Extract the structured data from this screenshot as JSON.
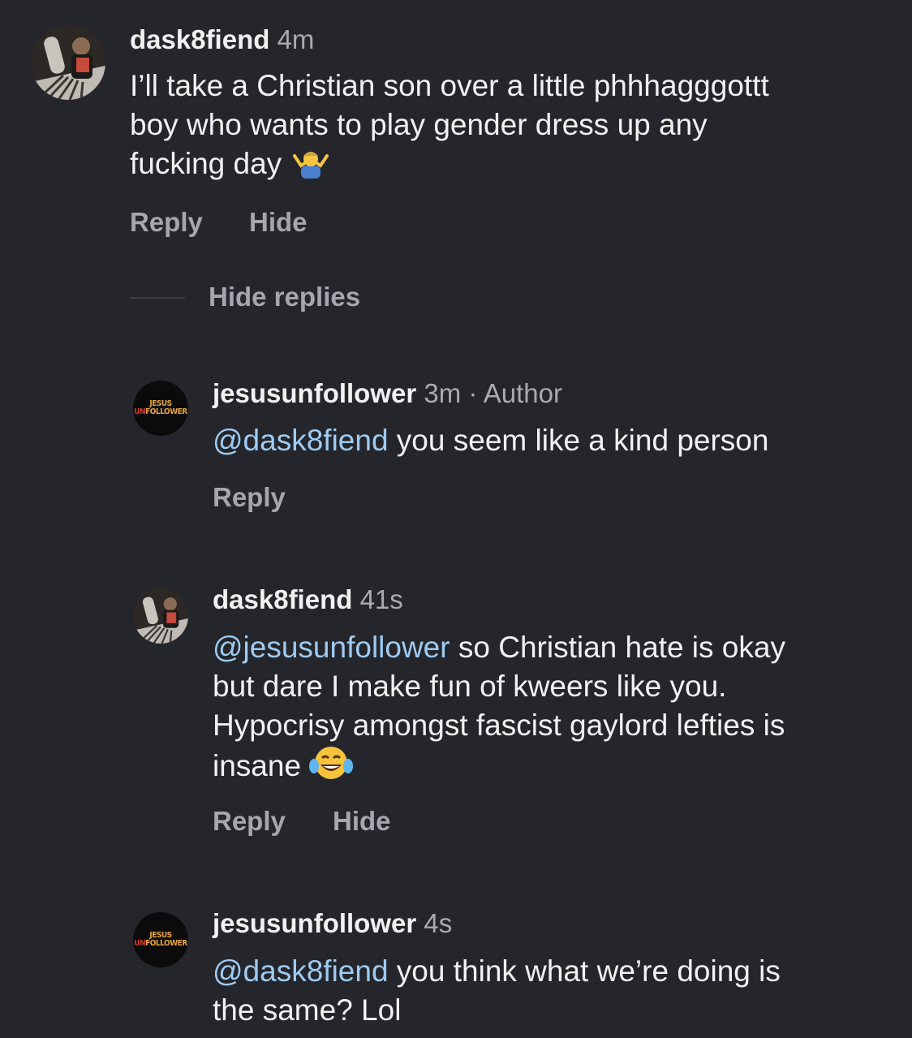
{
  "comments": [
    {
      "username": "dask8fiend",
      "time": "4m",
      "lines": [
        "I’ll take a Christian son over a little phhhagggottt",
        "boy who wants to play gender dress up any",
        "fucking day"
      ],
      "emoji": "person-shrugging-emoji",
      "actions": {
        "reply": "Reply",
        "hide": "Hide"
      }
    },
    {
      "username": "jesusunfollower",
      "time": "3m",
      "separator": "·",
      "badge": "Author",
      "mention": "@dask8fiend",
      "lines": [
        " you seem like a kind person"
      ],
      "actions": {
        "reply": "Reply"
      }
    },
    {
      "username": "dask8fiend",
      "time": "41s",
      "mention": "@jesusunfollower",
      "lines": [
        " so Christian hate is okay",
        "but dare I make fun of kweers like you.",
        "Hypocrisy amongst fascist gaylord lefties is",
        "insane"
      ],
      "emoji": "face-with-tears-of-joy-emoji",
      "actions": {
        "reply": "Reply",
        "hide": "Hide"
      }
    },
    {
      "username": "jesusunfollower",
      "time": "4s",
      "mention": "@dask8fiend",
      "lines": [
        " you think what we’re doing is",
        "the same? Lol"
      ]
    }
  ],
  "hide_replies": "Hide replies",
  "avatar_logo": {
    "line1": "JESUS",
    "line2_a": "UN",
    "line2_b": "FOLLOWER"
  },
  "colors": {
    "background": "#24262b",
    "mention": "#9fcbf2",
    "meta": "#a8abb1"
  }
}
